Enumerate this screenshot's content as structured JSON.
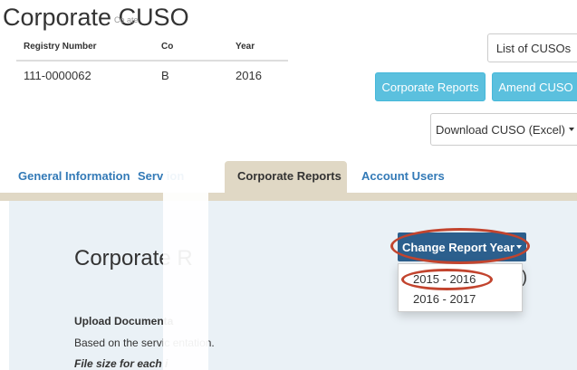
{
  "page": {
    "title": "Corporate CUSO",
    "subtitle": "Co    ate"
  },
  "registry_table": {
    "headers": [
      "Registry Number",
      "Co",
      "Year"
    ],
    "row": [
      "111-0000062",
      "B",
      "2016"
    ]
  },
  "buttons": {
    "list": "List of CUSOs",
    "corporate_reports": "Corporate Reports",
    "amend": "Amend CUSO",
    "download": "Download CUSO (Excel)"
  },
  "tabs": [
    {
      "label": "General Information",
      "active": false
    },
    {
      "label": "Serv      ion",
      "active": false
    },
    {
      "label": "Corporate Reports",
      "active": true
    },
    {
      "label": "Account Users",
      "active": false
    }
  ],
  "panel": {
    "title": "Corporate R",
    "trailing_text": "7)",
    "upload_heading": "Upload Documenta",
    "description": "Based on the servic            entation.",
    "file_size_note": "File size for each i"
  },
  "report_year_dropdown": {
    "button_label": "Change Report Year",
    "options": [
      "2015 - 2016",
      "2016 - 2017"
    ],
    "highlighted": "2015 - 2016"
  },
  "colors": {
    "link": "#337ab7",
    "info_button": "#5bc0de",
    "dropdown_button": "#2c5f8d",
    "tab_active": "#e0d8c5",
    "panel_bg": "#eaf1f6",
    "annotation": "#c2442e"
  }
}
